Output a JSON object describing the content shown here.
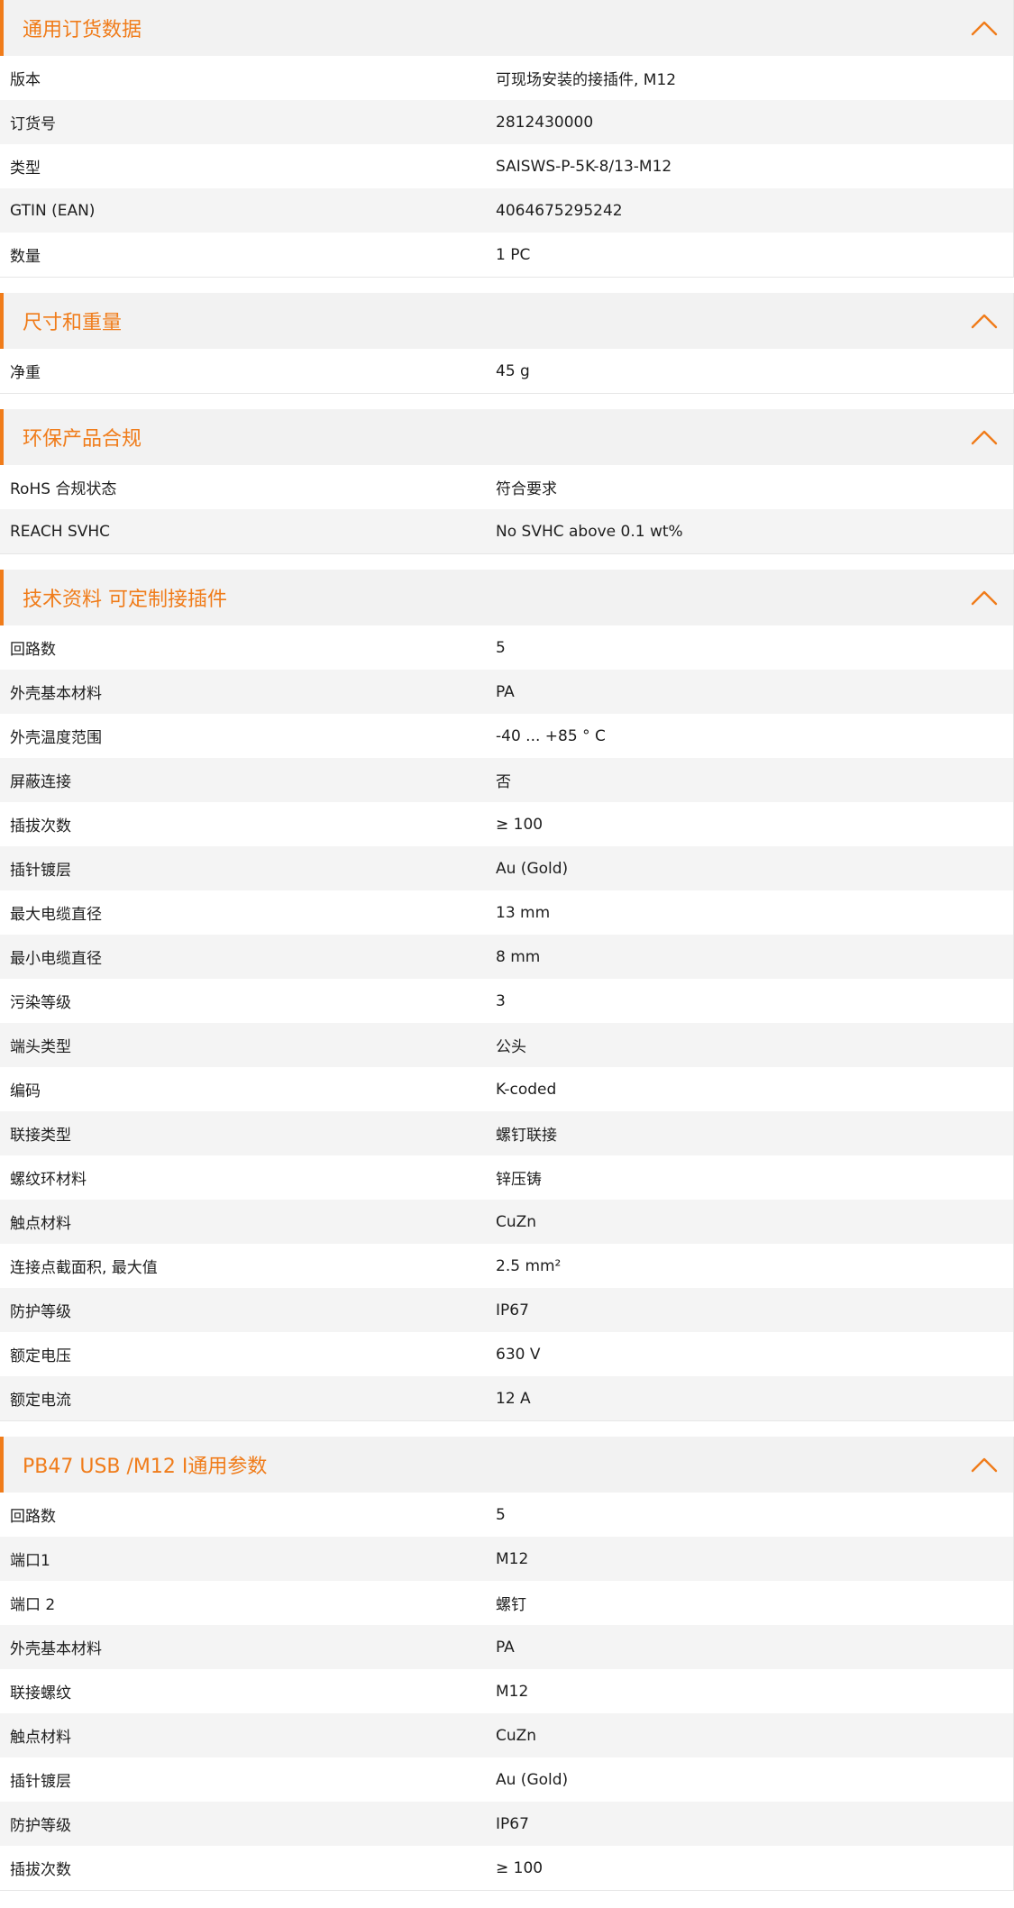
{
  "sections": [
    {
      "title": "通用订货数据",
      "rows": [
        {
          "label": "版本",
          "value": "可现场安装的接插件, M12"
        },
        {
          "label": "订货号",
          "value": "2812430000"
        },
        {
          "label": "类型",
          "value": "SAISWS-P-5K-8/13-M12"
        },
        {
          "label": "GTIN (EAN)",
          "value": "4064675295242"
        },
        {
          "label": "数量",
          "value": "1  PC"
        }
      ]
    },
    {
      "title": "尺寸和重量",
      "rows": [
        {
          "label": "净重",
          "value": "45  g"
        }
      ]
    },
    {
      "title": "环保产品合规",
      "rows": [
        {
          "label": "RoHS 合规状态",
          "value": "符合要求"
        },
        {
          "label": "REACH SVHC",
          "value": "No SVHC above 0.1 wt%"
        }
      ]
    },
    {
      "title": "技术资料 可定制接插件",
      "rows": [
        {
          "label": "回路数",
          "value": "5"
        },
        {
          "label": "外壳基本材料",
          "value": "PA"
        },
        {
          "label": "外壳温度范围",
          "value": "-40 ... +85 ° C"
        },
        {
          "label": "屏蔽连接",
          "value": "否"
        },
        {
          "label": "插拔次数",
          "value": "≥ 100"
        },
        {
          "label": "插针镀层",
          "value": "Au (Gold)"
        },
        {
          "label": "最大电缆直径",
          "value": "13  mm"
        },
        {
          "label": "最小电缆直径",
          "value": "8  mm"
        },
        {
          "label": "污染等级",
          "value": "3"
        },
        {
          "label": "端头类型",
          "value": "公头"
        },
        {
          "label": "编码",
          "value": "K-coded"
        },
        {
          "label": "联接类型",
          "value": "螺钉联接"
        },
        {
          "label": "螺纹环材料",
          "value": "锌压铸"
        },
        {
          "label": "触点材料",
          "value": "CuZn"
        },
        {
          "label": "连接点截面积, 最大值",
          "value": "2.5  mm²"
        },
        {
          "label": "防护等级",
          "value": "IP67"
        },
        {
          "label": "额定电压",
          "value": "630  V"
        },
        {
          "label": "额定电流",
          "value": "12  A"
        }
      ]
    },
    {
      "title": "PB47 USB /M12 I通用参数",
      "rows": [
        {
          "label": "回路数",
          "value": "5"
        },
        {
          "label": "端口1",
          "value": "M12"
        },
        {
          "label": "端口 2",
          "value": "螺钉"
        },
        {
          "label": "外壳基本材料",
          "value": "PA"
        },
        {
          "label": "联接螺纹",
          "value": "M12"
        },
        {
          "label": "触点材料",
          "value": "CuZn"
        },
        {
          "label": "插针镀层",
          "value": "Au (Gold)"
        },
        {
          "label": "防护等级",
          "value": "IP67"
        },
        {
          "label": "插拔次数",
          "value": "≥ 100"
        }
      ]
    }
  ],
  "colors": {
    "accent": "#f07c1a",
    "header_bg": "#f2f2f2",
    "row_alt_bg": "#f4f4f4"
  },
  "icons": {
    "collapse": "chevron-up-icon"
  }
}
